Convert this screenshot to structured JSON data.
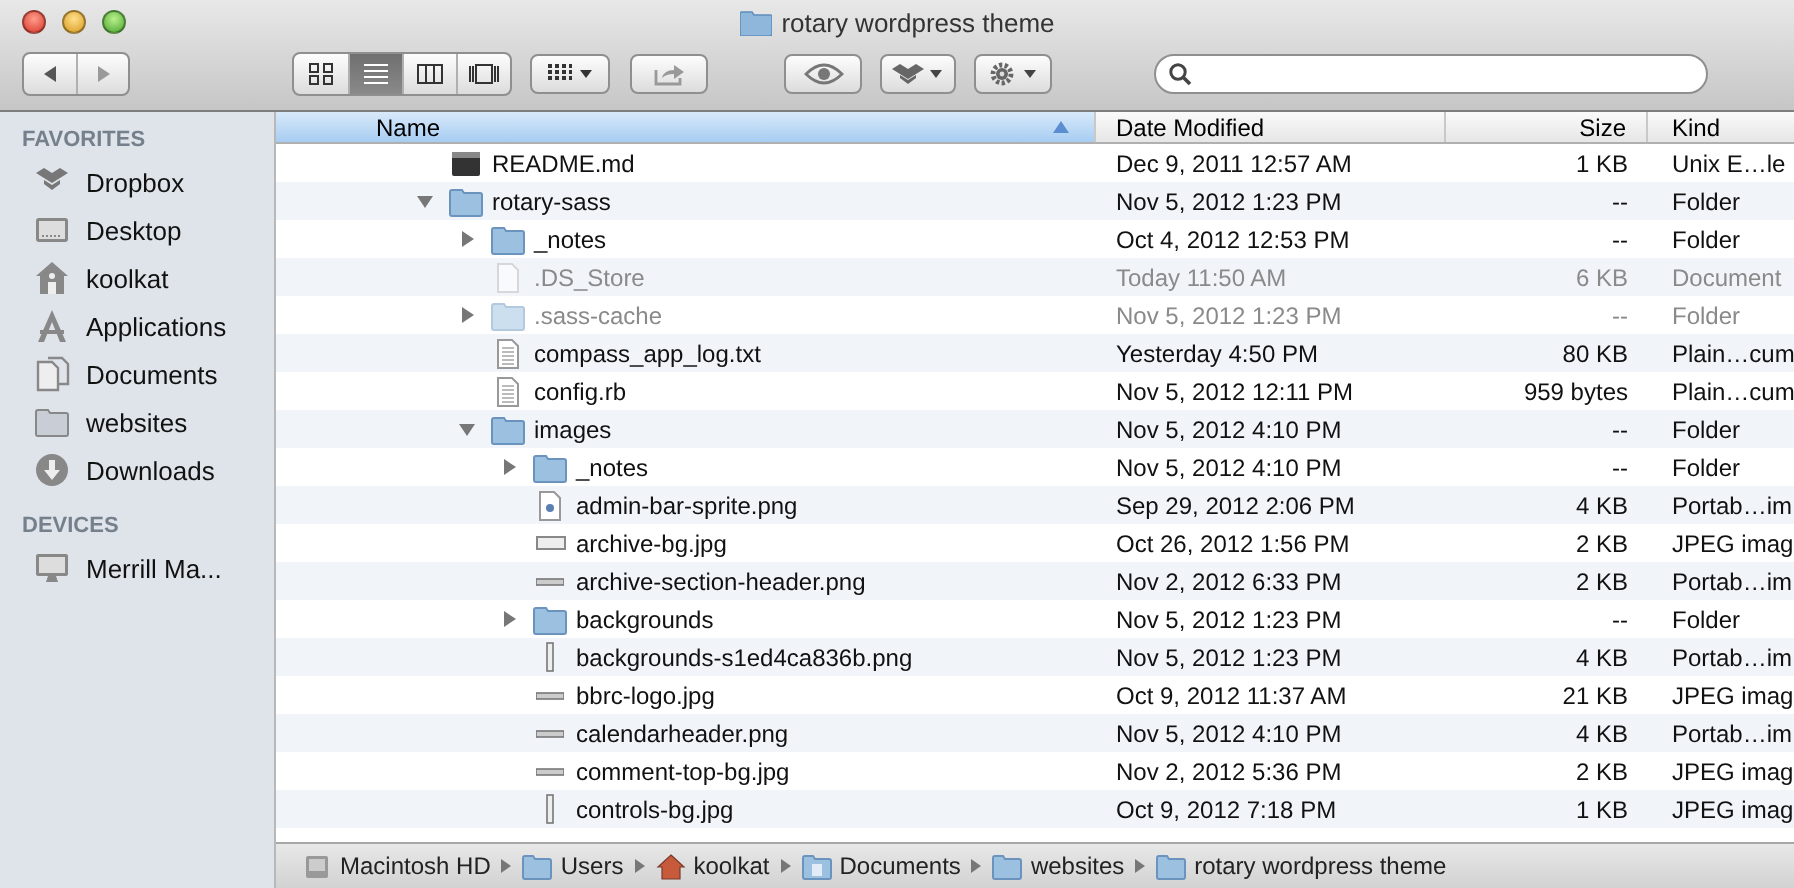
{
  "window": {
    "title": "rotary wordpress theme"
  },
  "toolbar": {
    "views": [
      {
        "kind": "icons",
        "selected": false
      },
      {
        "kind": "list",
        "selected": true
      },
      {
        "kind": "columns",
        "selected": false
      },
      {
        "kind": "coverflow",
        "selected": false
      }
    ]
  },
  "sidebar": {
    "sections": [
      {
        "title": "FAVORITES",
        "items": [
          {
            "label": "Dropbox"
          },
          {
            "label": "Desktop"
          },
          {
            "label": "koolkat"
          },
          {
            "label": "Applications"
          },
          {
            "label": "Documents"
          },
          {
            "label": "websites"
          },
          {
            "label": "Downloads"
          }
        ]
      },
      {
        "title": "DEVICES",
        "items": [
          {
            "label": "Merrill Ma..."
          }
        ]
      }
    ]
  },
  "table": {
    "columns": [
      {
        "label": "Name",
        "sorted": true
      },
      {
        "label": "Date Modified",
        "sorted": false
      },
      {
        "label": "Size",
        "sorted": false
      },
      {
        "label": "Kind",
        "sorted": false
      }
    ],
    "rows": [
      {
        "name": "README.md",
        "kind": "exec",
        "date": "Dec 9, 2011 12:57 AM",
        "size": "1 KB",
        "type": "Unix E…le",
        "dimmed": false
      },
      {
        "name": "rotary-sass",
        "kind": "folder",
        "expanded": true,
        "date": "Nov 5, 2012 1:23 PM",
        "size": "--",
        "type": "Folder",
        "dimmed": false,
        "children": [
          {
            "name": "_notes",
            "kind": "folder",
            "expanded": false,
            "date": "Oct 4, 2012 12:53 PM",
            "size": "--",
            "type": "Folder",
            "dimmed": false
          },
          {
            "name": ".DS_Store",
            "kind": "document",
            "date": "Today 11:50 AM",
            "size": "6 KB",
            "type": "Document",
            "dimmed": true
          },
          {
            "name": ".sass-cache",
            "kind": "folder",
            "expanded": false,
            "date": "Nov 5, 2012 1:23 PM",
            "size": "--",
            "type": "Folder",
            "dimmed": true
          },
          {
            "name": "compass_app_log.txt",
            "kind": "text",
            "date": "Yesterday 4:50 PM",
            "size": "80 KB",
            "type": "Plain…cum",
            "dimmed": false
          },
          {
            "name": "config.rb",
            "kind": "text",
            "date": "Nov 5, 2012 12:11 PM",
            "size": "959 bytes",
            "type": "Plain…cum",
            "dimmed": false
          },
          {
            "name": "images",
            "kind": "folder",
            "expanded": true,
            "date": "Nov 5, 2012 4:10 PM",
            "size": "--",
            "type": "Folder",
            "dimmed": false,
            "children": [
              {
                "name": "_notes",
                "kind": "folder",
                "expanded": false,
                "date": "Nov 5, 2012 4:10 PM",
                "size": "--",
                "type": "Folder",
                "dimmed": false
              },
              {
                "name": "admin-bar-sprite.png",
                "kind": "sprite",
                "date": "Sep 29, 2012 2:06 PM",
                "size": "4 KB",
                "type": "Portab…im",
                "dimmed": false
              },
              {
                "name": "archive-bg.jpg",
                "kind": "wide",
                "date": "Oct 26, 2012 1:56 PM",
                "size": "2 KB",
                "type": "JPEG imag",
                "dimmed": false
              },
              {
                "name": "archive-section-header.png",
                "kind": "strip",
                "date": "Nov 2, 2012 6:33 PM",
                "size": "2 KB",
                "type": "Portab…im",
                "dimmed": false
              },
              {
                "name": "backgrounds",
                "kind": "folder",
                "expanded": false,
                "date": "Nov 5, 2012 1:23 PM",
                "size": "--",
                "type": "Folder",
                "dimmed": false
              },
              {
                "name": "backgrounds-s1ed4ca836b.png",
                "kind": "tall",
                "date": "Nov 5, 2012 1:23 PM",
                "size": "4 KB",
                "type": "Portab…im",
                "dimmed": false
              },
              {
                "name": "bbrc-logo.jpg",
                "kind": "strip",
                "date": "Oct 9, 2012 11:37 AM",
                "size": "21 KB",
                "type": "JPEG imag",
                "dimmed": false
              },
              {
                "name": "calendarheader.png",
                "kind": "strip",
                "date": "Nov 5, 2012 4:10 PM",
                "size": "4 KB",
                "type": "Portab…im",
                "dimmed": false
              },
              {
                "name": "comment-top-bg.jpg",
                "kind": "strip",
                "date": "Nov 2, 2012 5:36 PM",
                "size": "2 KB",
                "type": "JPEG imag",
                "dimmed": false
              },
              {
                "name": "controls-bg.jpg",
                "kind": "tall",
                "date": "Oct 9, 2012 7:18 PM",
                "size": "1 KB",
                "type": "JPEG imag",
                "dimmed": false
              }
            ]
          }
        ]
      }
    ]
  },
  "path_bar": [
    {
      "label": "Macintosh HD"
    },
    {
      "label": "Users"
    },
    {
      "label": "koolkat"
    },
    {
      "label": "Documents"
    },
    {
      "label": "websites"
    },
    {
      "label": "rotary wordpress theme"
    }
  ]
}
